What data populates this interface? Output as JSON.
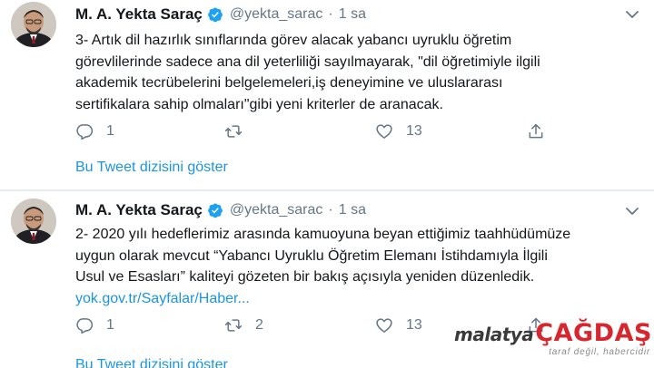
{
  "tweets": [
    {
      "name": "M. A. Yekta Saraç",
      "handle": "@yekta_sarac",
      "separator": "·",
      "time": "1 sa",
      "lines": [
        "3- Artık dil hazırlık sınıflarında görev alacak yabancı uyruklu öğretim",
        "görevlilerinde sadece ana dil yeterliliği sayılmayarak, \"dil öğretimiyle ilgili",
        "akademik tecrübelerini belgelemeleri,iş deneyimine ve uluslararası",
        "sertifikalara sahip olmaları\"gibi yeni kriterler de aranacak."
      ],
      "link": "",
      "reply_count": "1",
      "retweet_count": "",
      "like_count": "13",
      "thread_link": "Bu Tweet dizisini göster"
    },
    {
      "name": "M. A. Yekta Saraç",
      "handle": "@yekta_sarac",
      "separator": "·",
      "time": "1 sa",
      "lines": [
        "2- 2020 yılı hedeflerimiz arasında kamuoyuna beyan ettiğimiz taahhüdümüze",
        "uygun olarak mevcut “Yabancı Uyruklu Öğretim Elemanı İstihdamıyla İlgili",
        "Usul ve Esasları” kaliteyi gözeten bir bakış açısıyla yeniden düzenledik."
      ],
      "link": "yok.gov.tr/Sayfalar/Haber...",
      "reply_count": "1",
      "retweet_count": "2",
      "like_count": "13",
      "thread_link": "Bu Tweet dizisini göster"
    }
  ],
  "icons": {
    "verified": "verified-badge-icon",
    "reply": "reply-icon",
    "retweet": "retweet-icon",
    "like": "like-icon",
    "share": "share-icon",
    "caret": "chevron-down-icon"
  },
  "colors": {
    "text": "#14171a",
    "secondary": "#657786",
    "link": "#1b95e0",
    "verified": "#1da1f2",
    "divider": "#e6ecf0",
    "watermark_red": "#d7262e"
  },
  "watermark": {
    "part1": "malatya",
    "part2": "ÇAĞDAŞ",
    "slogan": "taraf değil, habercidir"
  }
}
